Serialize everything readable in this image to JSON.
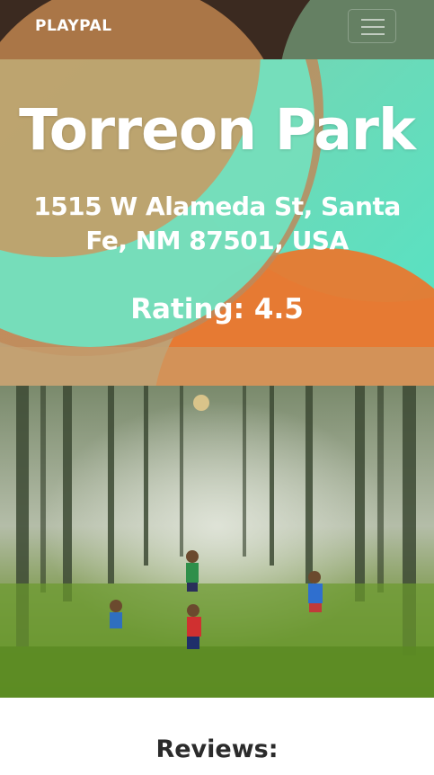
{
  "nav": {
    "brand": "PLAYPAL",
    "menu_icon": "hamburger-menu-icon"
  },
  "hero": {
    "title": "Torreon Park",
    "address": "1515 W Alameda St, Santa Fe, NM 87501, USA",
    "rating": "Rating: 4.5"
  },
  "photo": {
    "subject": "park-photo"
  },
  "reviews": {
    "heading": "Reviews:"
  },
  "colors": {
    "navbar": "#3b2a20",
    "hero_orange": "#e07a33",
    "hero_teal": "#5ee3c4",
    "hero_tan": "#b59063",
    "text": "#ffffff"
  }
}
